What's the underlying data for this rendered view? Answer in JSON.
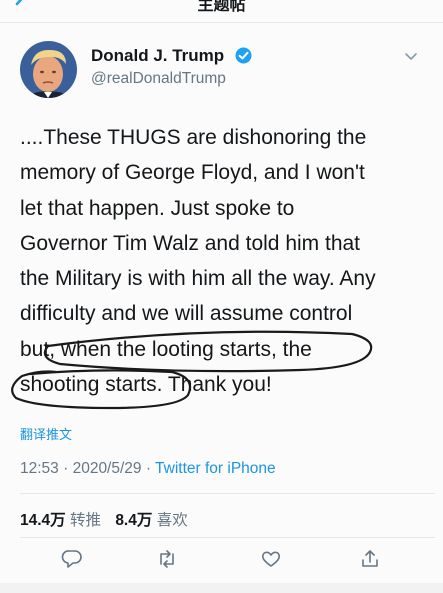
{
  "nav": {
    "title": "主题帖",
    "back_icon": "chevron-left-icon"
  },
  "author": {
    "display_name": "Donald J. Trump",
    "handle": "@realDonaldTrump",
    "verified_icon": "verified-badge-icon"
  },
  "tweet": {
    "lines": [
      "....These THUGS are dishonoring the",
      "memory of George Floyd, and I won't",
      "let that happen. Just spoke to",
      "Governor Tim Walz and told him that",
      "the Military is with him all the way. Any",
      "difficulty and we will assume control",
      "but, when the looting starts, the",
      "shooting starts. Thank you!"
    ],
    "translate_label": "翻译推文"
  },
  "meta": {
    "time": "12:53",
    "separator": " · ",
    "date": "2020/5/29",
    "source": "Twitter for iPhone"
  },
  "stats": {
    "retweets_count": "14.4万",
    "retweets_label": "转推",
    "likes_count": "8.4万",
    "likes_label": "喜欢"
  },
  "actions": [
    "reply-icon",
    "retweet-icon",
    "like-icon",
    "share-icon"
  ],
  "colors": {
    "accent": "#1b95e0",
    "secondary_text": "#657786",
    "annotation_ink": "#1a1a1a"
  }
}
